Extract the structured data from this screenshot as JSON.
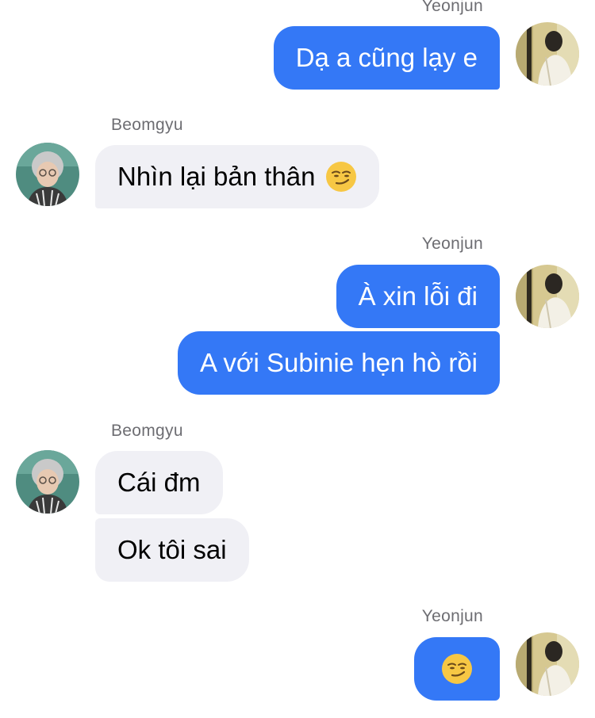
{
  "conversation": {
    "messages": [
      {
        "sender": "Yeonjun",
        "side": "right",
        "texts": [
          "Dạ a cũng lạy e"
        ]
      },
      {
        "sender": "Beomgyu",
        "side": "left",
        "texts": [
          "Nhìn lại bản thân"
        ],
        "emoji": "smirk-emoji"
      },
      {
        "sender": "Yeonjun",
        "side": "right",
        "texts": [
          "À xin lỗi đi",
          "A với Subinie hẹn hò rồi"
        ]
      },
      {
        "sender": "Beomgyu",
        "side": "left",
        "texts": [
          "Cái đm",
          "Ok tôi sai"
        ]
      },
      {
        "sender": "Yeonjun",
        "side": "right",
        "texts": [],
        "emoji": "smirk-emoji"
      }
    ]
  },
  "colors": {
    "outgoing_bubble": "#3478f6",
    "incoming_bubble": "#f0f0f5",
    "sender_name": "#6d6d72",
    "background": "#ffffff"
  }
}
